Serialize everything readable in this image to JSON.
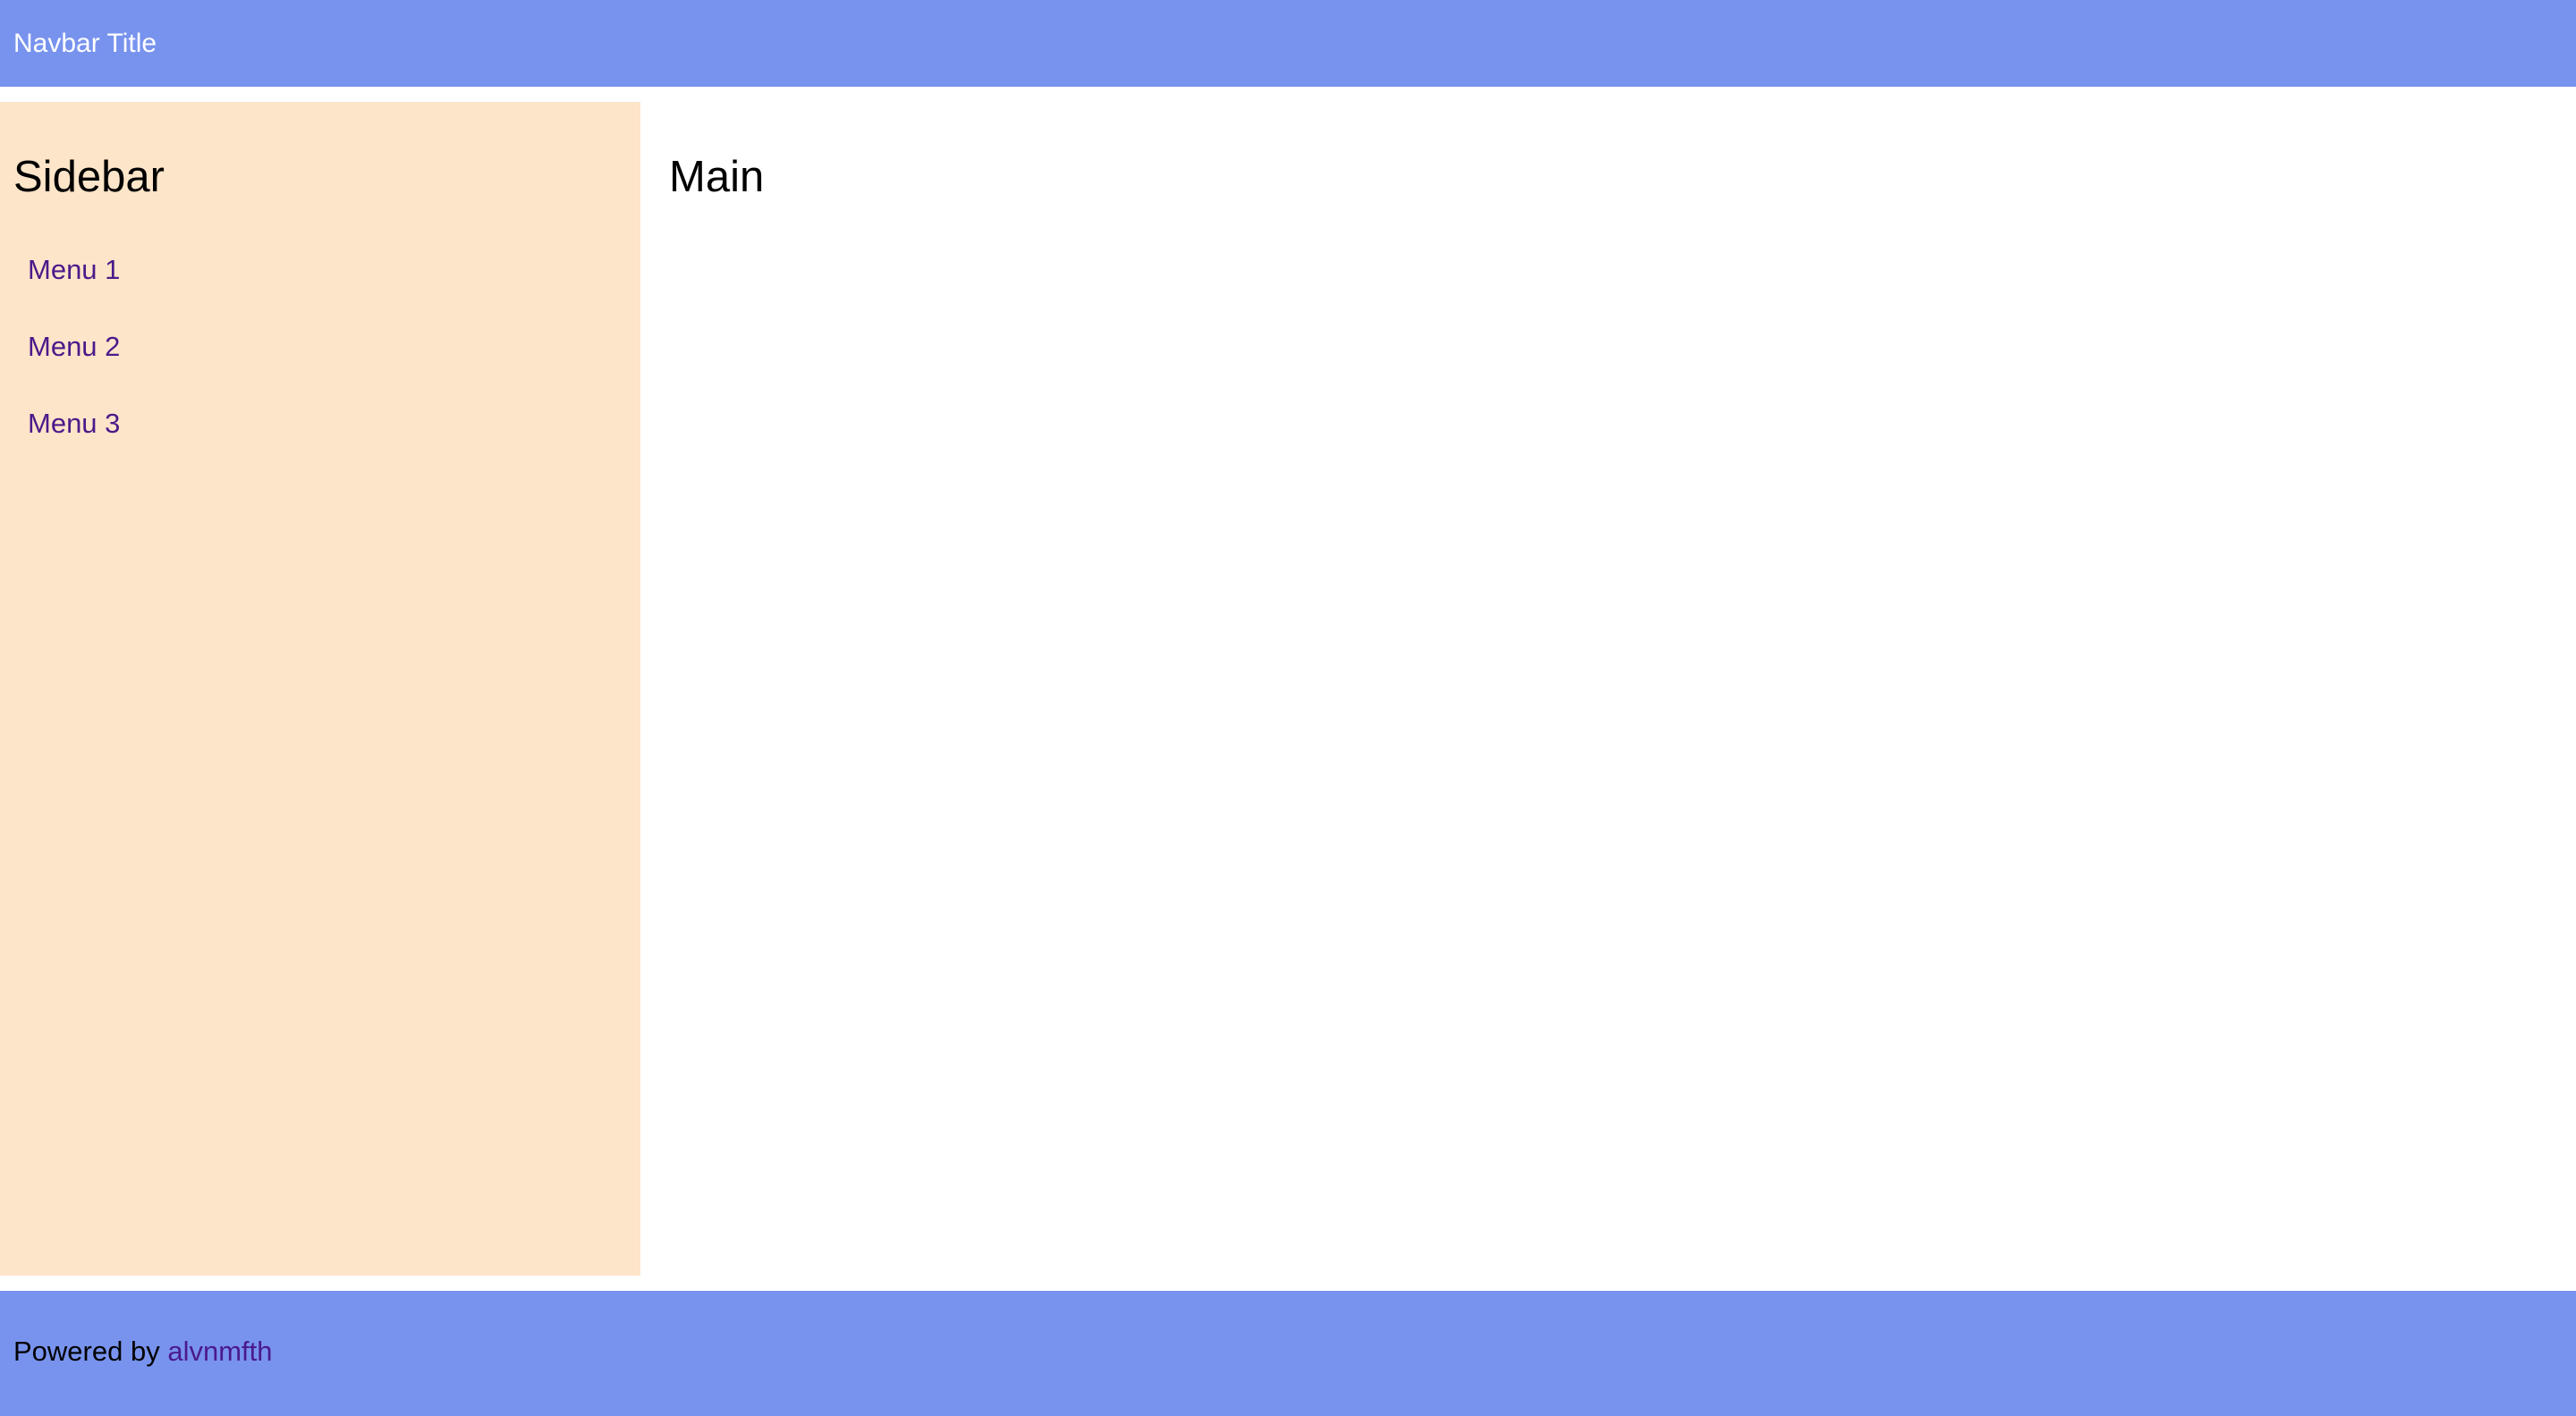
{
  "navbar": {
    "title": "Navbar Title",
    "color": "#7893ee"
  },
  "sidebar": {
    "heading": "Sidebar",
    "background": "#fce5c9",
    "items": [
      {
        "label": "Menu 1"
      },
      {
        "label": "Menu 2"
      },
      {
        "label": "Menu 3"
      }
    ]
  },
  "main": {
    "heading": "Main"
  },
  "footer": {
    "prefix": "Powered by",
    "link_text": "alvnmfth",
    "link_color": "#4b1a8a"
  }
}
